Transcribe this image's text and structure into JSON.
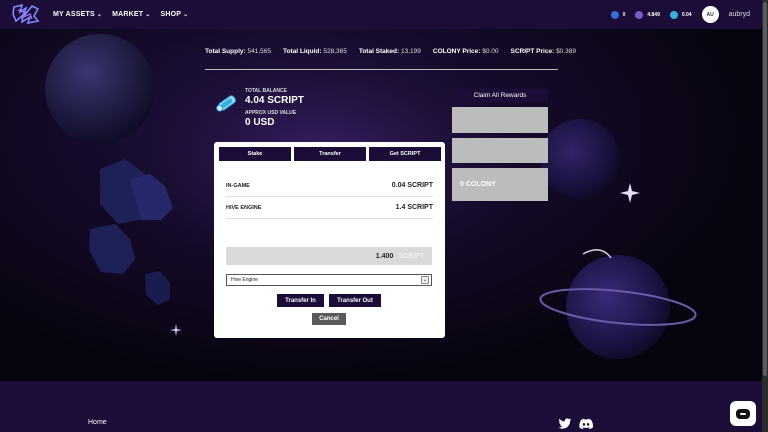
{
  "nav": {
    "menu": [
      {
        "label": "MY ASSETS",
        "icon": "chevron-down-icon"
      },
      {
        "label": "MARKET",
        "icon": "chevron-down-icon"
      },
      {
        "label": "SHOP",
        "icon": "chevron-down-icon"
      }
    ],
    "balances": [
      {
        "value": "0",
        "icon": "plus-token-icon",
        "color": "#3a6bd8"
      },
      {
        "value": "4.849",
        "icon": "hive-token-icon",
        "color": "#7a5cc8"
      },
      {
        "value": "0.04",
        "icon": "script-token-icon",
        "color": "#3ab0e0"
      }
    ],
    "avatar_initials": "AU",
    "username": "aubryd"
  },
  "stats": [
    {
      "label": "Total Supply:",
      "value": "541,565"
    },
    {
      "label": "Total Liquid:",
      "value": "528,365"
    },
    {
      "label": "Total Staked:",
      "value": "13,199"
    },
    {
      "label": "COLONY Price:",
      "value": "$0.00"
    },
    {
      "label": "SCRIPT Price:",
      "value": "$0.389"
    }
  ],
  "balance": {
    "total_label": "TOTAL BALANCE",
    "total_value": "4.04 SCRIPT",
    "usd_label": "APPROX USD VALUE",
    "usd_value": "0 USD"
  },
  "rewards": {
    "claim_label": "Claim All Rewards",
    "colony_reward": "0 COLONY"
  },
  "card": {
    "tabs": [
      "Stake",
      "Transfer",
      "Get SCRIPT"
    ],
    "rows": [
      {
        "label": "IN-GAME",
        "value": "0.04 SCRIPT"
      },
      {
        "label": "HIVE ENGINE",
        "value": "1.4 SCRIPT"
      }
    ],
    "amount": {
      "value": "1.400",
      "unit": "SCRIPT"
    },
    "select_value": "Hive Engine",
    "transfer_in": "Transfer In",
    "transfer_out": "Transfer Out",
    "cancel": "Cancel"
  },
  "footer": {
    "home": "Home",
    "social": [
      "twitter-icon",
      "discord-icon"
    ]
  },
  "colors": {
    "nav_bg": "#1c0c38",
    "accent": "#1c0c38",
    "reward_box": "#bcbcbc"
  }
}
